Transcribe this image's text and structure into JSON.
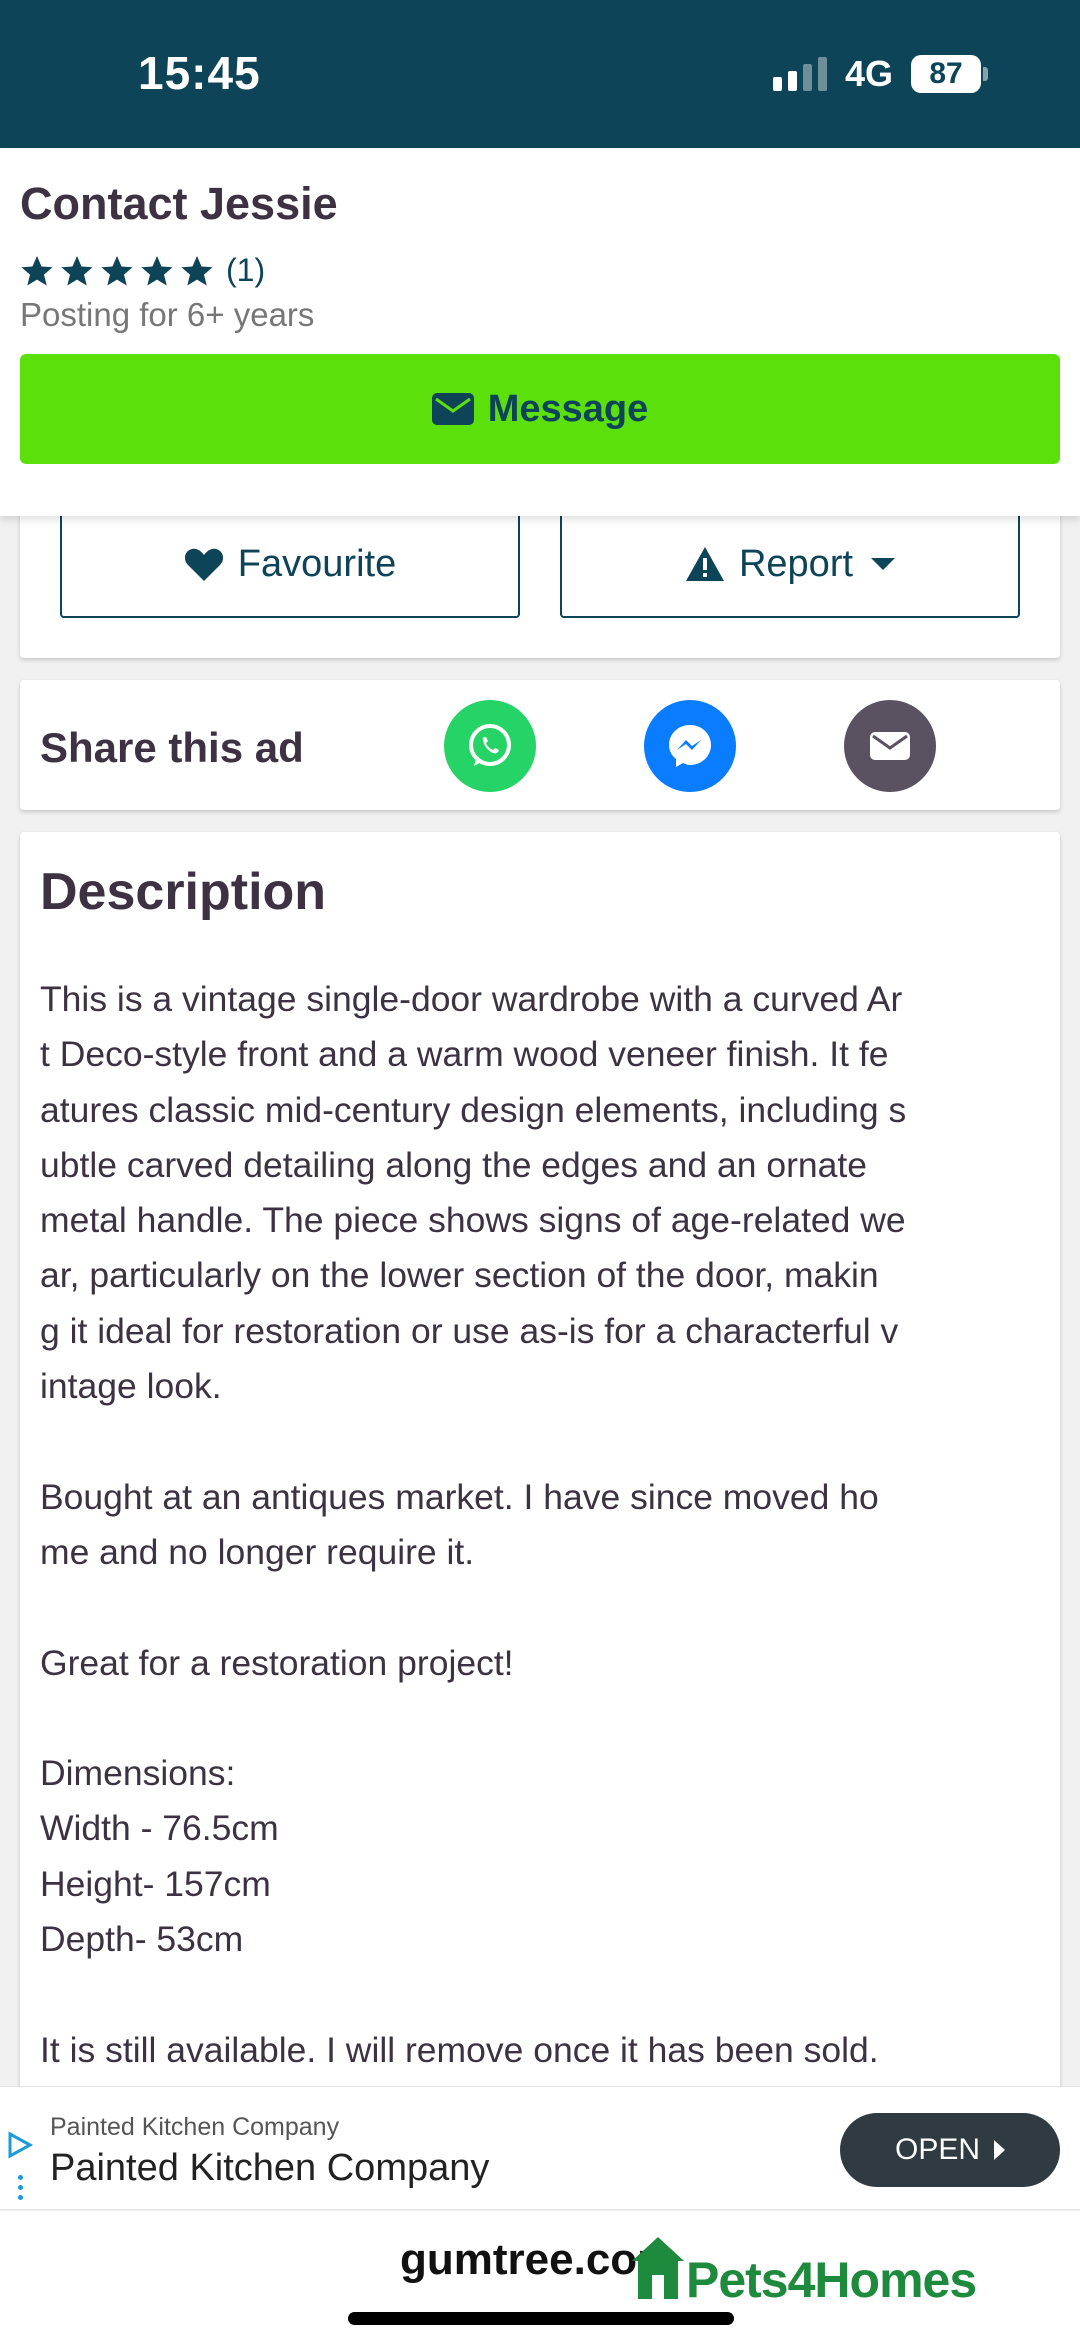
{
  "status_bar": {
    "time": "15:45",
    "network": "4G",
    "battery": "87"
  },
  "contact": {
    "title": "Contact Jessie",
    "stars": 5,
    "rating_count": "(1)",
    "posting_for": "Posting for 6+ years",
    "message_label": "Message"
  },
  "actions": {
    "favourite_label": "Favourite",
    "report_label": "Report"
  },
  "share": {
    "title": "Share this ad",
    "icons": [
      "whatsapp-icon",
      "messenger-icon",
      "email-icon"
    ]
  },
  "description": {
    "title": "Description",
    "lines": [
      "This is a vintage single-door wardrobe with a curved Ar",
      "t Deco-style front and a warm wood veneer finish. It fe",
      "atures classic mid-century design elements, including s",
      "ubtle carved detailing along the edges and an ornate",
      "metal handle. The piece shows signs of age-related we",
      "ar, particularly on the lower section of the door, makin",
      "g it ideal for restoration or use as-is for a characterful v",
      "intage look.",
      "",
      "Bought at an antiques market. I have since moved ho",
      "me and no longer require it.",
      "",
      "Great for a restoration project!",
      "",
      "Dimensions:",
      "Width - 76.5cm",
      "Height- 157cm",
      "Depth- 53cm",
      "",
      "It is still available. I will remove once it has been sold."
    ]
  },
  "ad": {
    "advertiser_small": "Painted Kitchen Company",
    "advertiser_big": "Painted Kitchen Company",
    "open_label": "OPEN"
  },
  "footer": {
    "gumtree_text": "gumtree.com",
    "pets_text": "Pets4Homes"
  },
  "colors": {
    "brand_dark": "#0e4457",
    "message_green": "#5ce00b",
    "whatsapp": "#25d366",
    "messenger": "#0a7cff",
    "email": "#5b5261"
  }
}
